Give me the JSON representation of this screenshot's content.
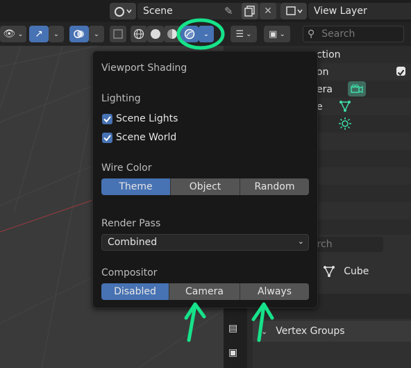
{
  "topbar": {
    "scene_label": "Scene",
    "view_layer_label": "View Layer"
  },
  "header": {
    "search_placeholder": "Search"
  },
  "outliner": {
    "rows": [
      "ction",
      "on",
      "era",
      "e",
      ""
    ]
  },
  "properties": {
    "search_placeholder": "arch",
    "object_name": "Cube",
    "vertex_groups_label": "Vertex Groups"
  },
  "popup": {
    "title": "Viewport Shading",
    "lighting": {
      "heading": "Lighting",
      "scene_lights": "Scene Lights",
      "scene_world": "Scene World",
      "scene_lights_checked": true,
      "scene_world_checked": true
    },
    "wire_color": {
      "heading": "Wire Color",
      "options": [
        "Theme",
        "Object",
        "Random"
      ],
      "selected": "Theme"
    },
    "render_pass": {
      "heading": "Render Pass",
      "value": "Combined"
    },
    "compositor": {
      "heading": "Compositor",
      "options": [
        "Disabled",
        "Camera",
        "Always"
      ],
      "selected": "Disabled"
    }
  },
  "colors": {
    "accent": "#4772b3",
    "annotation": "#16e28a",
    "popup_bg": "#181818"
  }
}
